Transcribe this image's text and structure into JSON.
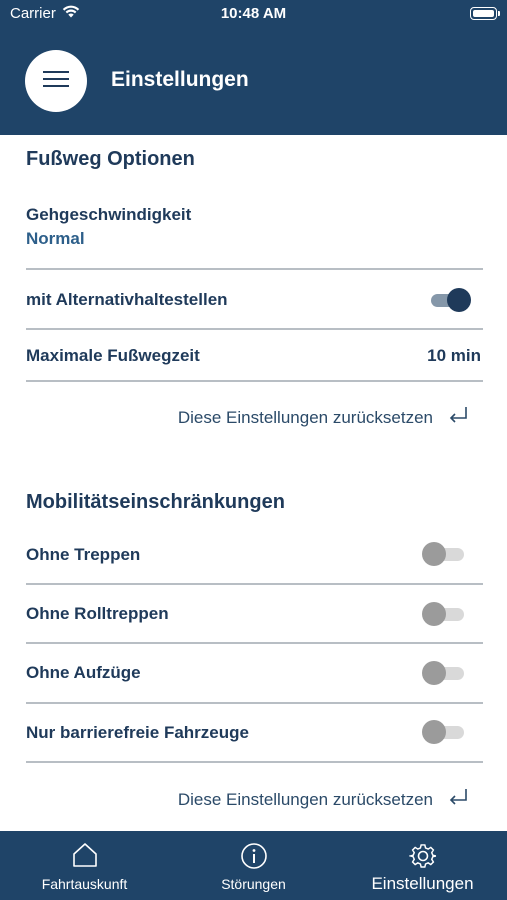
{
  "status_bar": {
    "carrier": "Carrier",
    "time": "10:48 AM",
    "icons": [
      "wifi-icon",
      "battery-icon"
    ]
  },
  "header": {
    "title": "Einstellungen",
    "menu_icon": "hamburger-menu-icon"
  },
  "walking": {
    "section_title": "Fußweg Optionen",
    "speed_label": "Gehgeschwindigkeit",
    "speed_value": "Normal",
    "alternative_stops_label": "mit Alternativhaltestellen",
    "alternative_stops_enabled": true,
    "max_walk_label": "Maximale Fußwegzeit",
    "max_walk_value": "10 min",
    "reset_label": "Diese Einstellungen zurücksetzen"
  },
  "mobility": {
    "section_title": "Mobilitätseinschränkungen",
    "options": [
      {
        "label": "Ohne Treppen",
        "enabled": false
      },
      {
        "label": "Ohne Rolltreppen",
        "enabled": false
      },
      {
        "label": "Ohne Aufzüge",
        "enabled": false
      },
      {
        "label": "Nur barrierefreie Fahrzeuge",
        "enabled": false
      }
    ],
    "reset_label": "Diese Einstellungen zurücksetzen"
  },
  "tabbar": {
    "tabs": [
      {
        "label": "Fahrtauskunft",
        "icon": "home-icon",
        "active": false
      },
      {
        "label": "Störungen",
        "icon": "info-icon",
        "active": false
      },
      {
        "label": "Einstellungen",
        "icon": "gear-icon",
        "active": true
      }
    ]
  },
  "colors": {
    "header_bg": "#1f4468",
    "text_primary": "#1f3a5a",
    "accent_value": "#2d5f8a",
    "toggle_on_knob": "#1f3a5a",
    "toggle_off_knob": "#9b9b9b"
  }
}
